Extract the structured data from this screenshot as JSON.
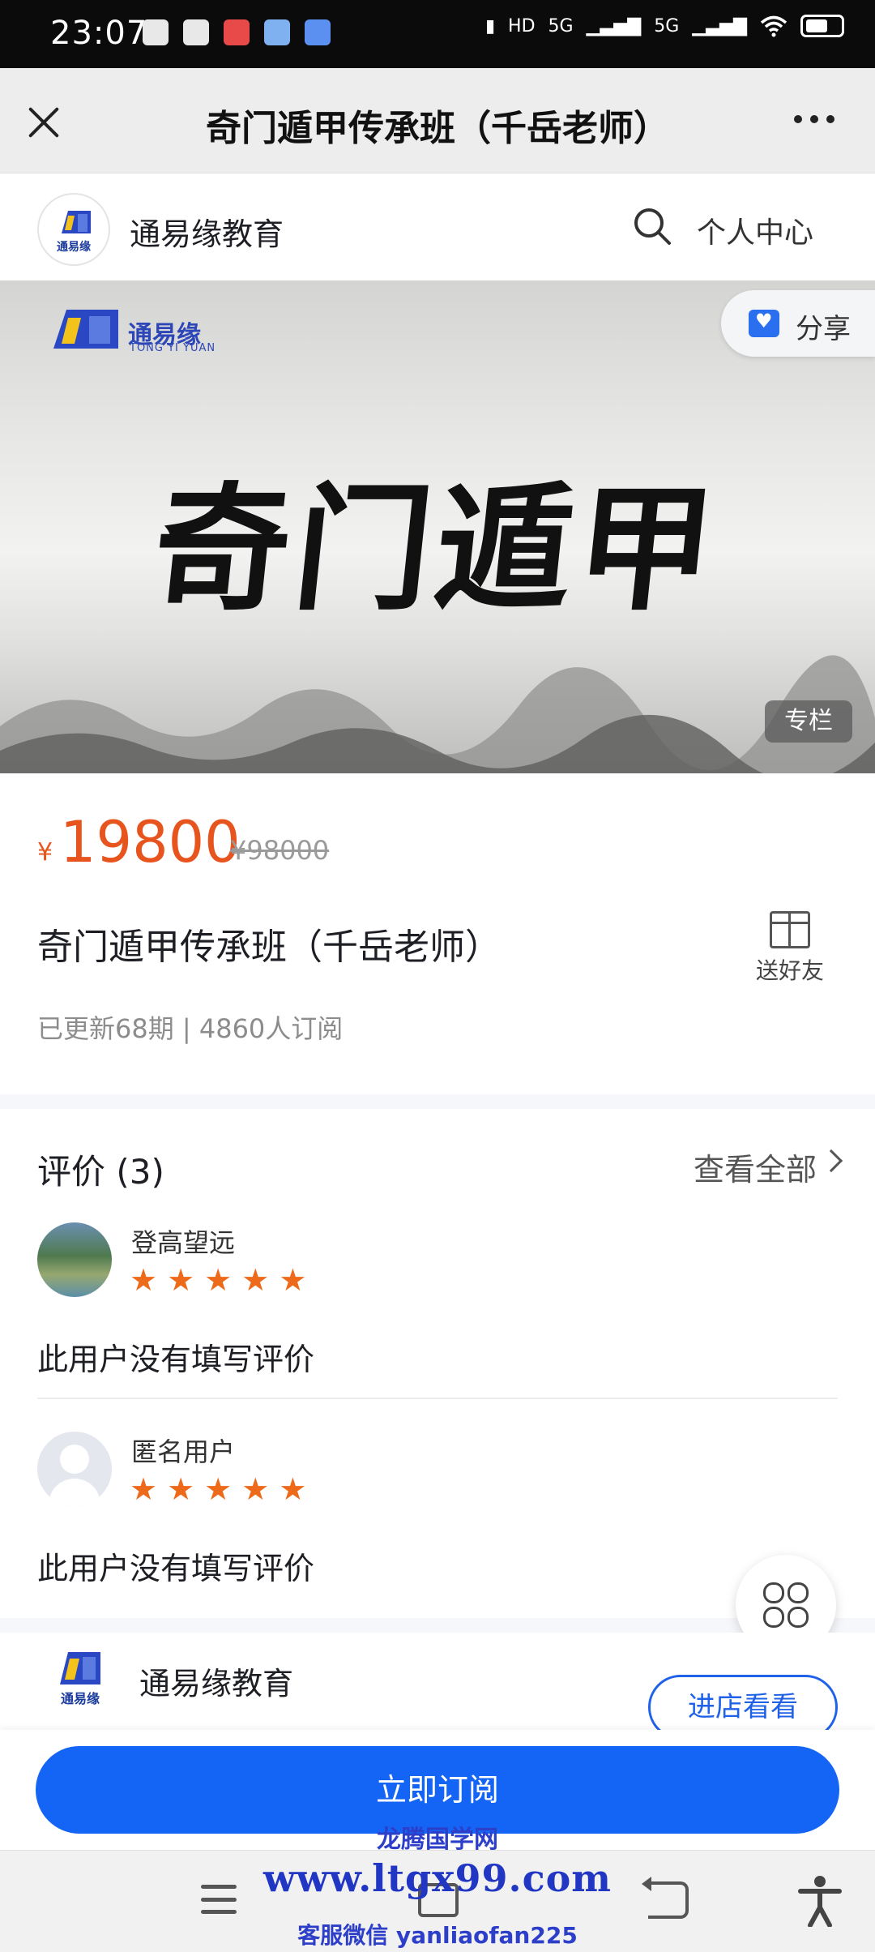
{
  "status_bar": {
    "time": "23:07",
    "network_labels": [
      "HD",
      "5G",
      "5G"
    ],
    "icons": [
      "sim-icon",
      "alipay-icon",
      "wps-icon",
      "app-icon",
      "baidu-icon",
      "vibrate-icon",
      "signal-icon",
      "wifi-icon",
      "battery-icon"
    ]
  },
  "title_bar": {
    "title": "奇门遁甲传承班（千岳老师）"
  },
  "shop_header": {
    "shop_name": "通易缘教育",
    "logo_text": "通易缘",
    "personal_center": "个人中心"
  },
  "banner": {
    "logo_text": "通易缘",
    "logo_subtext": "TONG YI YUAN",
    "title": "奇门遁甲",
    "share_label": "分享",
    "tag": "专栏"
  },
  "product": {
    "currency": "¥",
    "price": "19800",
    "original_price": "¥98000",
    "title": "奇门遁甲传承班（千岳老师）",
    "gift_label": "送好友",
    "meta": "已更新68期 | 4860人订阅"
  },
  "reviews": {
    "heading": "评价 (3)",
    "view_all": "查看全部",
    "items": [
      {
        "name": "登高望远",
        "rating": 5,
        "text": "此用户没有填写评价"
      },
      {
        "name": "匿名用户",
        "rating": 5,
        "text": "此用户没有填写评价"
      }
    ]
  },
  "store": {
    "name": "通易缘教育",
    "logo_text": "通易缘",
    "enter_label": "进店看看"
  },
  "subscribe": {
    "label": "立即订阅"
  },
  "watermark": {
    "line1": "龙腾国学网",
    "line2": "www.ltgx99.com",
    "line3": "客服微信 yanliaofan225"
  },
  "colors": {
    "accent": "#1464f6",
    "price": "#e8541e",
    "star": "#ec6a1a"
  }
}
